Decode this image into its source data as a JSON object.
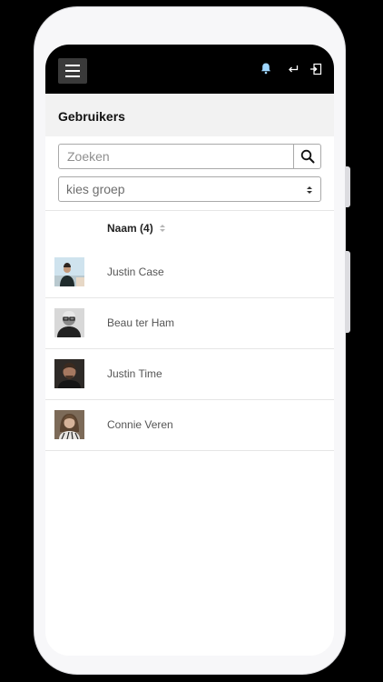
{
  "header": {
    "title": "Gebruikers"
  },
  "topbar": {
    "icons": [
      "menu-icon",
      "bell-icon",
      "back-arrow-icon",
      "logout-icon"
    ],
    "bell_color": "#9fd7ff"
  },
  "search": {
    "placeholder": "Zoeken",
    "value": ""
  },
  "group_select": {
    "selected": "kies groep"
  },
  "table": {
    "column_header": "Naam (4)",
    "rows": [
      {
        "name": "Justin Case"
      },
      {
        "name": "Beau ter Ham"
      },
      {
        "name": "Justin Time"
      },
      {
        "name": "Connie Veren"
      }
    ]
  }
}
